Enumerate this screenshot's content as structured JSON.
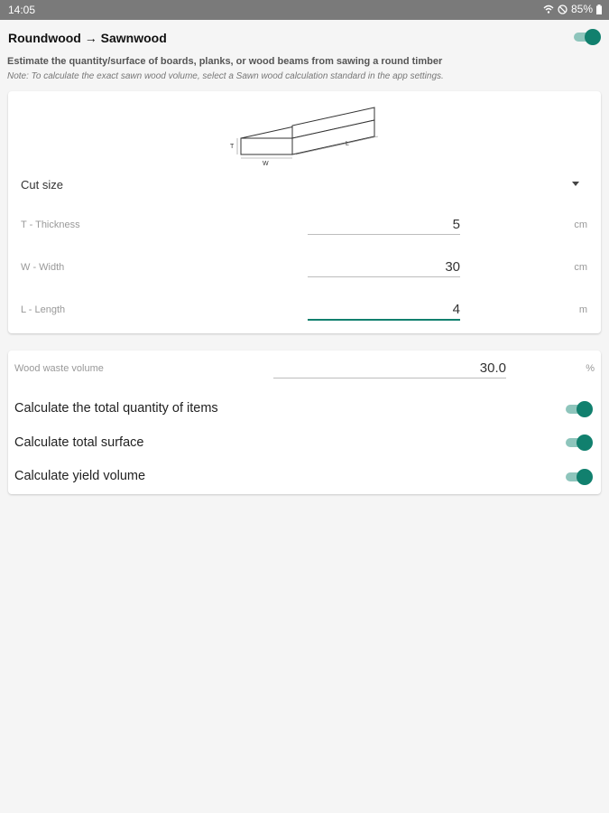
{
  "status_bar": {
    "time": "14:05",
    "battery": "85%"
  },
  "header": {
    "title": "Roundwood → Sawnwood",
    "toggle_on": true
  },
  "description": "Estimate the quantity/surface of boards, planks, or wood beams from sawing a round timber",
  "note": "Note: To calculate the exact sawn wood volume, select a Sawn wood calculation standard in the app settings.",
  "diagram": {
    "label_t": "T",
    "label_w": "W",
    "label_l": "L"
  },
  "cut_size": {
    "label": "Cut size"
  },
  "fields": {
    "thickness": {
      "label": "T - Thickness",
      "value": "5",
      "unit": "cm"
    },
    "width": {
      "label": "W - Width",
      "value": "30",
      "unit": "cm"
    },
    "length": {
      "label": "L - Length",
      "value": "4",
      "unit": "m"
    }
  },
  "waste": {
    "label": "Wood waste volume",
    "value": "30.0",
    "unit": "%"
  },
  "options": [
    {
      "label": "Calculate the total quantity of items",
      "on": true
    },
    {
      "label": "Calculate total surface",
      "on": true
    },
    {
      "label": "Calculate yield volume",
      "on": true
    }
  ],
  "colors": {
    "accent": "#11806e",
    "accent_track": "#8ec5bc",
    "status_bar": "#7a7a7a"
  }
}
